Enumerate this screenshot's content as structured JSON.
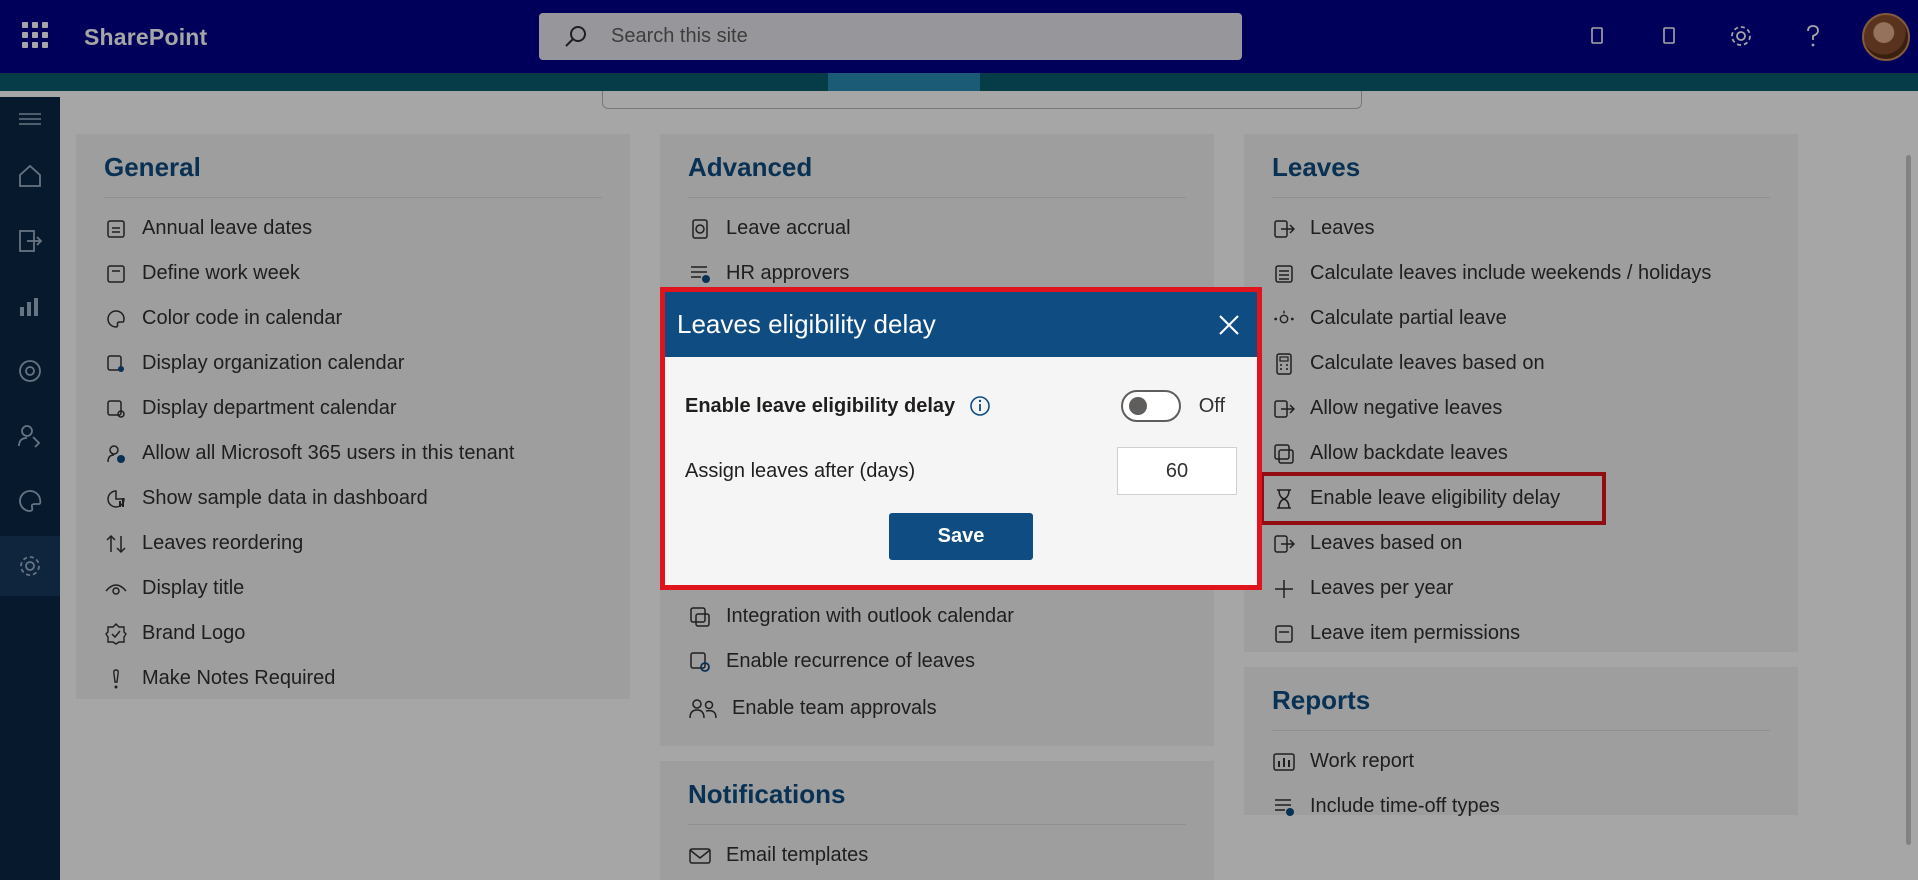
{
  "suitebar": {
    "brand": "SharePoint",
    "search_placeholder": "Search this site"
  },
  "panels": {
    "general": {
      "title": "General",
      "items": [
        {
          "label": "Annual leave dates",
          "icon": "calendar-icon"
        },
        {
          "label": "Define work week",
          "icon": "calendar-week-icon"
        },
        {
          "label": "Color code in calendar",
          "icon": "palette-icon"
        },
        {
          "label": "Display organization calendar",
          "icon": "calendar-person-icon"
        },
        {
          "label": "Display department calendar",
          "icon": "calendar-eye-icon"
        },
        {
          "label": "Allow all Microsoft 365 users in this tenant",
          "icon": "person-check-icon"
        },
        {
          "label": "Show sample data in dashboard",
          "icon": "chart-data-icon"
        },
        {
          "label": "Leaves reordering",
          "icon": "reorder-arrows-icon"
        },
        {
          "label": "Display title",
          "icon": "eye-icon"
        },
        {
          "label": "Brand Logo",
          "icon": "badge-check-icon"
        },
        {
          "label": "Make Notes Required",
          "icon": "exclamation-icon"
        }
      ]
    },
    "advanced": {
      "title": "Advanced",
      "items": [
        {
          "label": "Leave accrual",
          "icon": "accrual-icon"
        },
        {
          "label": "HR approvers",
          "icon": "list-check-icon"
        },
        {
          "label": "Integration with outlook calendar",
          "icon": "calendar-sync-icon"
        },
        {
          "label": "Enable recurrence of leaves",
          "icon": "calendar-repeat-icon"
        },
        {
          "label": "Enable team approvals",
          "icon": "people-icon"
        }
      ]
    },
    "notifications": {
      "title": "Notifications",
      "items": [
        {
          "label": "Email templates",
          "icon": "mail-icon"
        }
      ]
    },
    "leaves": {
      "title": "Leaves",
      "items": [
        {
          "label": "Leaves",
          "icon": "arrow-exit-icon"
        },
        {
          "label": "Calculate leaves include weekends / holidays",
          "icon": "document-lines-icon"
        },
        {
          "label": "Calculate partial leave",
          "icon": "partial-icon"
        },
        {
          "label": "Calculate leaves based on",
          "icon": "calculator-icon"
        },
        {
          "label": "Allow negative leaves",
          "icon": "arrow-exit-icon"
        },
        {
          "label": "Allow backdate leaves",
          "icon": "calendar-stack-icon"
        },
        {
          "label": "Enable leave eligibility delay",
          "icon": "hourglass-icon"
        },
        {
          "label": "Leaves based on",
          "icon": "arrow-exit-icon"
        },
        {
          "label": "Leaves per year",
          "icon": "plus-icon"
        },
        {
          "label": "Leave item permissions",
          "icon": "document-icon"
        }
      ]
    },
    "reports": {
      "title": "Reports",
      "items": [
        {
          "label": "Work report",
          "icon": "bar-report-icon"
        },
        {
          "label": "Include time-off types",
          "icon": "list-check-icon"
        }
      ]
    }
  },
  "dialog": {
    "title": "Leaves eligibility delay",
    "toggle_label": "Enable leave eligibility delay",
    "toggle_state": "Off",
    "days_label": "Assign leaves after (days)",
    "days_value": "60",
    "save_label": "Save"
  },
  "colors": {
    "suitebar": "#00008b",
    "accent": "#0f4c81",
    "highlight": "#e0141c",
    "rail": "#0b2744"
  }
}
